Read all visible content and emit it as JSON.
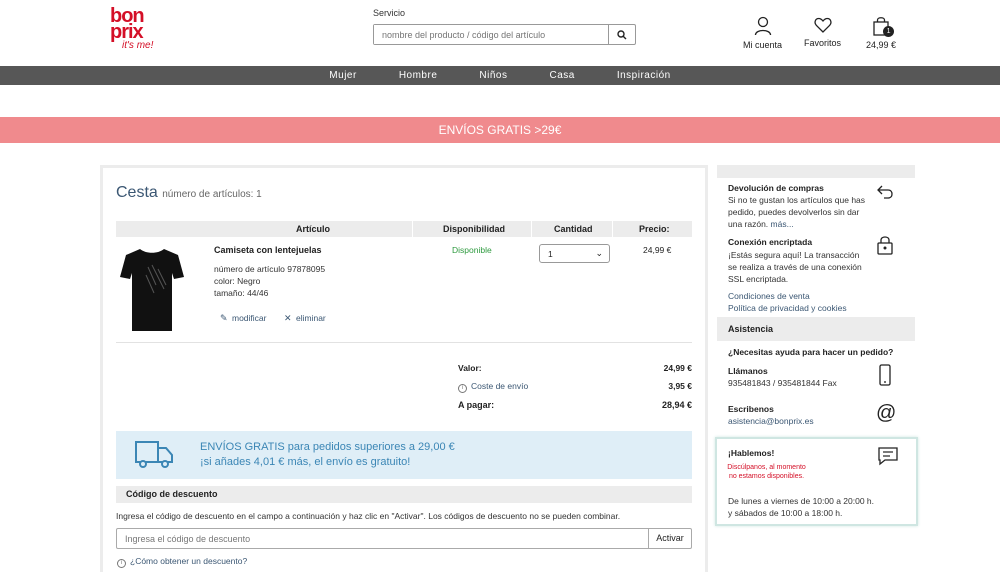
{
  "header": {
    "logo_line1": "bon",
    "logo_line2": "prix",
    "logo_tagline": "it's me!",
    "service_link": "Servicio",
    "search_placeholder": "nombre del producto / código del artículo",
    "account_label": "Mi cuenta",
    "favorites_label": "Favoritos",
    "cart_total": "24,99 €",
    "cart_count": "1"
  },
  "nav": {
    "items": [
      "Mujer",
      "Hombre",
      "Niños",
      "Casa",
      "Inspiración"
    ]
  },
  "promo_banner": "ENVÍOS GRATIS >29€",
  "cart": {
    "title": "Cesta",
    "count_text": "número de artículos: 1",
    "columns": [
      "Artículo",
      "Disponibilidad",
      "Cantidad",
      "Precio:"
    ],
    "item": {
      "name": "Camiseta con lentejuelas",
      "number": "número de artículo 97878095",
      "color": "color: Negro",
      "size": "tamaño: 44/46",
      "edit_label": "modificar",
      "remove_label": "eliminar",
      "availability": "Disponible",
      "quantity": "1",
      "price": "24,99 €"
    },
    "summary": {
      "value_label": "Valor:",
      "value": "24,99 €",
      "shipping_label": "Coste de envío",
      "shipping": "3,95 €",
      "total_label": "A pagar:",
      "total": "28,94 €"
    },
    "free_shipping": {
      "line1": "ENVÍOS GRATIS para pedidos superiores a 29,00 €",
      "line2": "¡si añades 4,01 € más, el envío es gratuito!"
    },
    "discount": {
      "heading": "Código de descuento",
      "description": "Ingresa el código de descuento en el campo a continuación y haz clic en \"Activar\". Los códigos de descuento no se pueden combinar.",
      "placeholder": "Ingresa el código de descuento",
      "button": "Activar",
      "help_link": "¿Cómo obtener un descuento?"
    }
  },
  "sidebar": {
    "returns_title": "Devolución de compras",
    "returns_text": "Si no te gustan los artículos que has pedido, puedes devolverlos sin dar una razón.",
    "returns_more": "más...",
    "secure_title": "Conexión encriptada",
    "secure_text": "¡Estás segura aquí! La transacción se realiza a través de una conexión SSL encriptada.",
    "terms_link": "Condiciones de venta",
    "privacy_link": "Política de privacidad y cookies",
    "assist_heading": "Asistencia",
    "help_question": "¿Necesitas ayuda para hacer un pedido?",
    "call_title": "Llámanos",
    "call_numbers": "935481843 / 935481844 Fax",
    "write_title": "Escribenos",
    "write_email": "asistencia@bonprix.es",
    "chat_title": "¡Hablemos!",
    "chat_error": "Discúlpanos, al momento no estamos disponibles.",
    "chat_hours_1": "De lunes a viernes de 10:00 a 20:00 h.",
    "chat_hours_2": "y sábados de 10:00 a 18:00 h."
  }
}
